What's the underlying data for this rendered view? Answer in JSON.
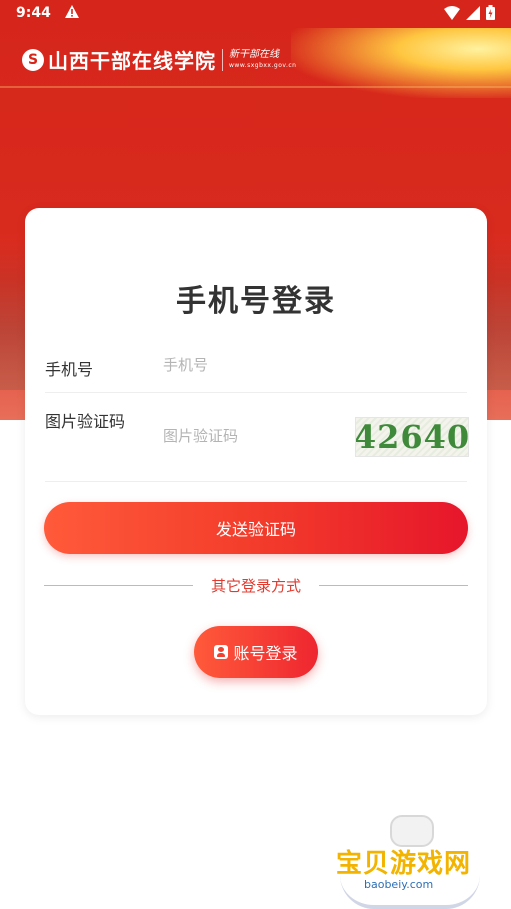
{
  "status_bar": {
    "time": "9:44",
    "warning_icon": "alert-triangle-icon",
    "icons": [
      "wifi-icon",
      "signal-icon",
      "battery-icon"
    ]
  },
  "header": {
    "logo_mark": "S",
    "site_name": "山西干部在线学院",
    "slogan": "新干部在线",
    "url": "www.sxgbxx.gov.cn"
  },
  "login": {
    "title": "手机号登录",
    "phone_label": "手机号",
    "phone_placeholder": "手机号",
    "captcha_label": "图片验证码",
    "captcha_placeholder": "图片验证码",
    "captcha_text": "42640",
    "send_button": "发送验证码",
    "other_methods": "其它登录方式",
    "account_button": "账号登录",
    "account_icon": "user-card-icon"
  },
  "watermark": {
    "name": "宝贝游戏网",
    "url": "baobeiy.com"
  },
  "colors": {
    "primary": "#e6162b",
    "header_red": "#d6261b",
    "accent_text": "#e23a2e"
  }
}
